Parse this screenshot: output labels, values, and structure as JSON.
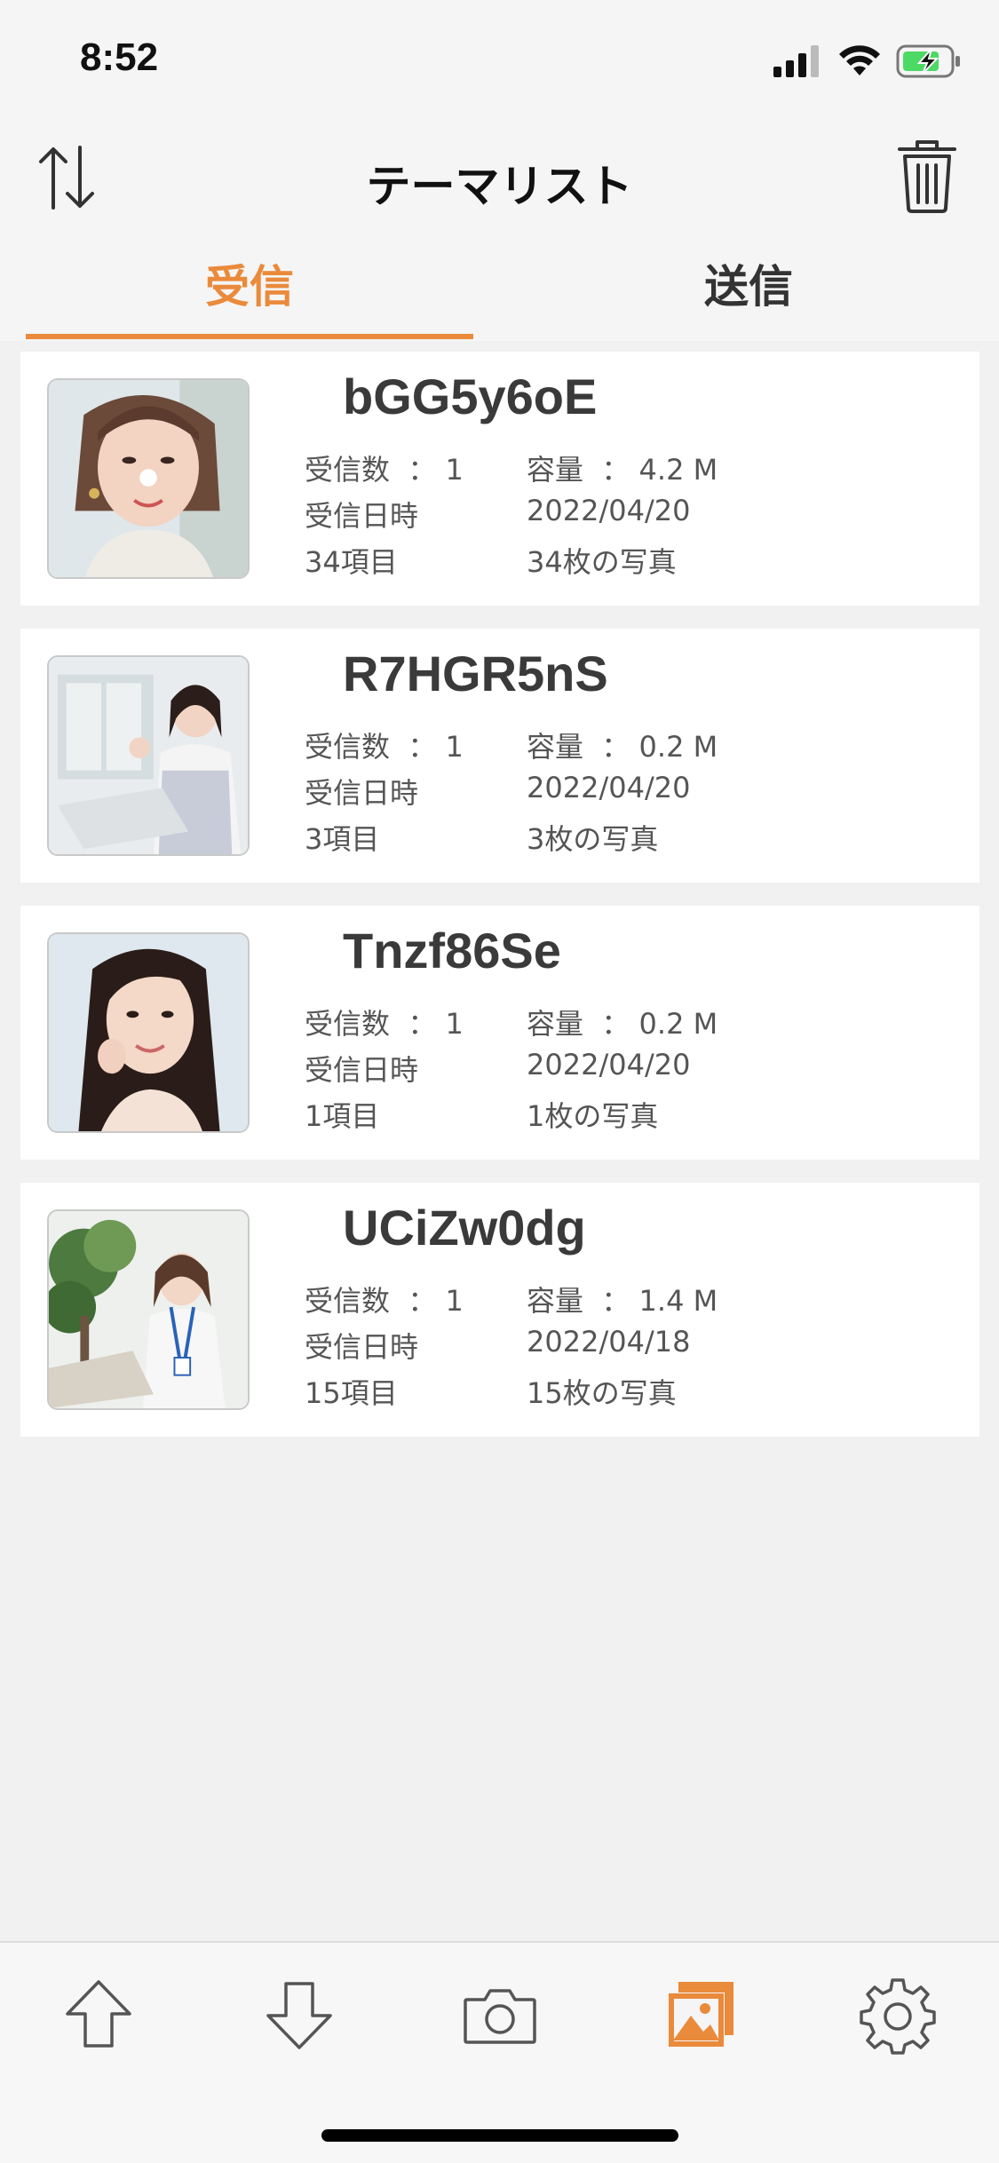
{
  "status": {
    "time": "8:52"
  },
  "header": {
    "title": "テーマリスト"
  },
  "tabs": {
    "received": "受信",
    "sent": "送信"
  },
  "labels": {
    "receive_count": "受信数",
    "capacity": "容量",
    "colon": "：",
    "receive_datetime": "受信日時"
  },
  "items": [
    {
      "name": "bGG5y6oE",
      "count": "1",
      "size": "4.2 M",
      "date": "2022/04/20",
      "items_label": "34項目",
      "photos_label": "34枚の写真"
    },
    {
      "name": "R7HGR5nS",
      "count": "1",
      "size": "0.2 M",
      "date": "2022/04/20",
      "items_label": "3項目",
      "photos_label": "3枚の写真"
    },
    {
      "name": "Tnzf86Se",
      "count": "1",
      "size": "0.2 M",
      "date": "2022/04/20",
      "items_label": "1項目",
      "photos_label": "1枚の写真"
    },
    {
      "name": "UCiZw0dg",
      "count": "1",
      "size": "1.4 M",
      "date": "2022/04/18",
      "items_label": "15項目",
      "photos_label": "15枚の写真"
    }
  ],
  "colors": {
    "accent": "#ea8a3b",
    "background": "#f1f1f1",
    "card": "#ffffff"
  },
  "tabbar": {
    "icons": [
      "upload-icon",
      "download-icon",
      "camera-icon",
      "gallery-icon",
      "settings-icon"
    ],
    "active": "gallery-icon"
  }
}
